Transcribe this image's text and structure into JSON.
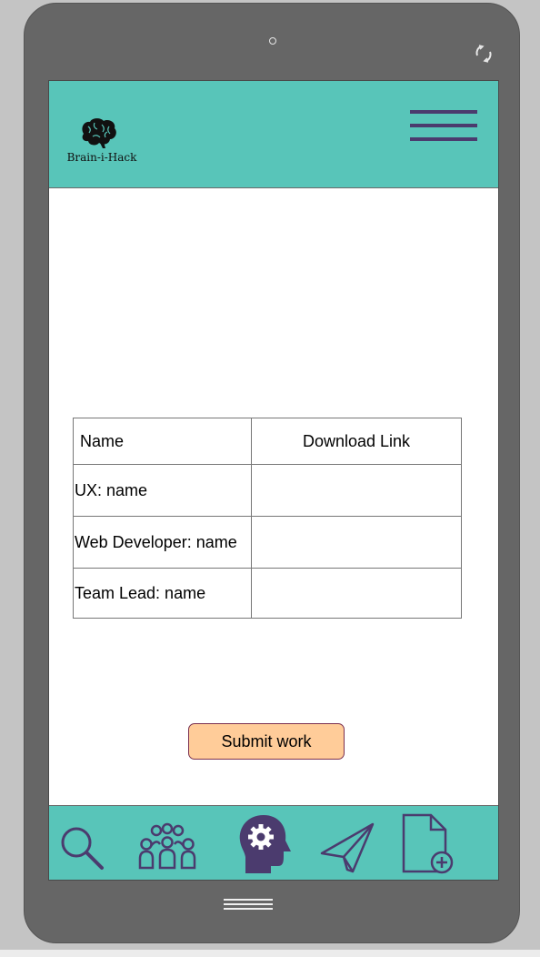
{
  "app": {
    "logo_text": "Brain-i-Hack",
    "logo_icon": "brain-icon",
    "menu_icon": "hamburger-menu-icon"
  },
  "table": {
    "headers": [
      "Name",
      "Download Link"
    ],
    "rows": [
      {
        "role": "UX: name",
        "link": ""
      },
      {
        "role": "Web Developer: name",
        "link": ""
      },
      {
        "role": "Team Lead: name",
        "link": ""
      }
    ]
  },
  "submit": {
    "label": "Submit work"
  },
  "bottom_nav": [
    {
      "icon": "search-icon"
    },
    {
      "icon": "team-icon"
    },
    {
      "icon": "brain-settings-icon",
      "active": true
    },
    {
      "icon": "send-icon"
    },
    {
      "icon": "add-file-icon"
    }
  ],
  "colors": {
    "accent": "#58c5b9",
    "nav_icon": "#4b3b6e",
    "button": "#ffcc99",
    "phone_frame": "#666666"
  }
}
